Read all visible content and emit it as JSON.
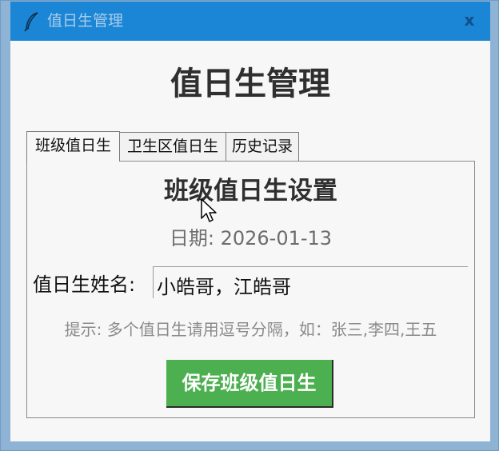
{
  "window": {
    "title": "值日生管理",
    "icon": "feather-icon",
    "close_label": "x"
  },
  "header": {
    "title": "值日生管理"
  },
  "tabs": [
    {
      "label": "班级值日生",
      "active": true
    },
    {
      "label": "卫生区值日生",
      "active": false
    },
    {
      "label": "历史记录",
      "active": false
    }
  ],
  "panel": {
    "title": "班级值日生设置",
    "date": "日期: 2026-01-13",
    "name_label": "值日生姓名:",
    "name_value": "小皓哥，江皓哥",
    "hint": "提示: 多个值日生请用逗号分隔，如：张三,李四,王五",
    "save_label": "保存班级值日生"
  },
  "colors": {
    "titlebar": "#1c86d6",
    "save_button": "#4caf50"
  }
}
